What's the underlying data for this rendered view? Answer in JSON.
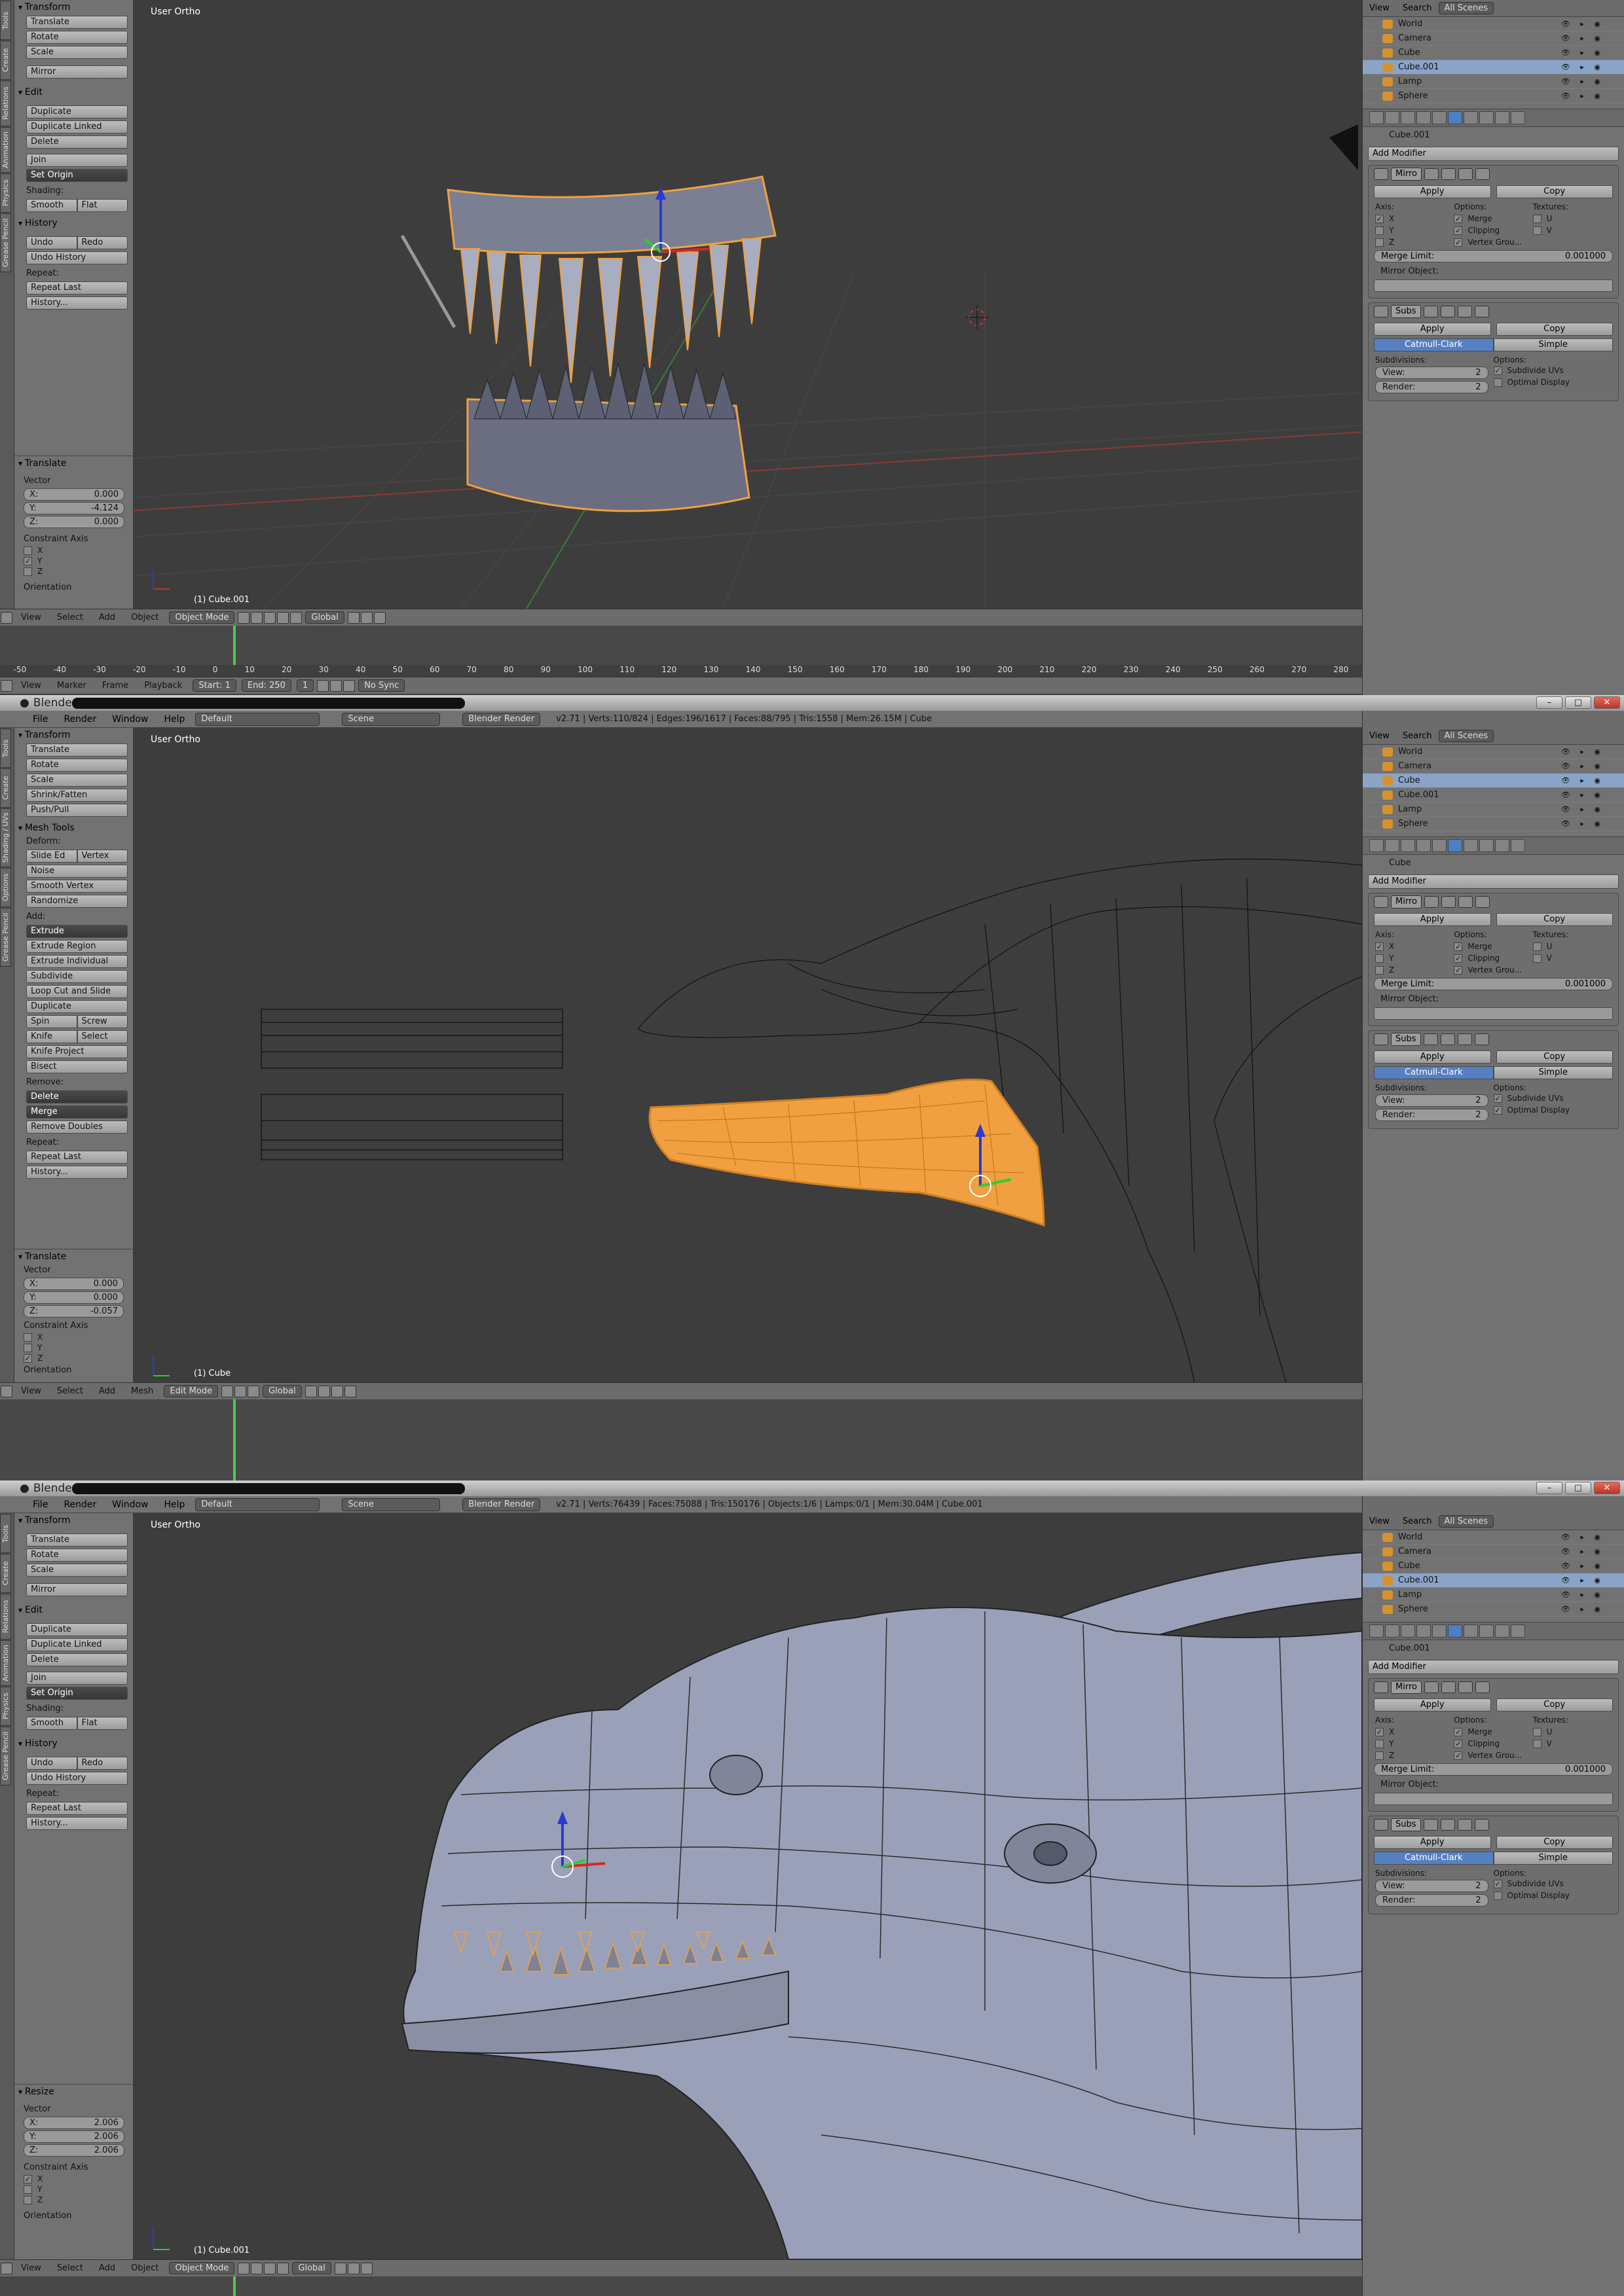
{
  "panels": [
    {
      "id": "top",
      "viewport_label": "User Ortho",
      "object_label": "(1) Cube.001",
      "mode": "Object Mode",
      "orientation": "Global",
      "tool_sections": {
        "transform_title": "Transform",
        "transform_buttons": [
          "Translate",
          "Rotate",
          "Scale"
        ],
        "mirror": "Mirror",
        "edit_title": "Edit",
        "edit_buttons": [
          "Duplicate",
          "Duplicate Linked",
          "Delete"
        ],
        "join": "Join",
        "set_origin": "Set Origin",
        "shading_label": "Shading:",
        "shading": [
          "Smooth",
          "Flat"
        ],
        "history_title": "History",
        "undo_redo": [
          "Undo",
          "Redo"
        ],
        "undo_history": "Undo History",
        "repeat_label": "Repeat:",
        "repeat_buttons": [
          "Repeat Last",
          "History..."
        ]
      },
      "operator": {
        "title": "Translate",
        "vector_label": "Vector",
        "values": [
          {
            "axis": "X:",
            "value": "0.000"
          },
          {
            "axis": "Y:",
            "value": "-4.124"
          },
          {
            "axis": "Z:",
            "value": "0.000"
          }
        ],
        "constraint_label": "Constraint Axis",
        "constraints": [
          {
            "axis": "X",
            "checked": false
          },
          {
            "axis": "Y",
            "checked": true
          },
          {
            "axis": "Z",
            "checked": false
          }
        ],
        "orientation_label": "Orientation"
      },
      "timeline": {
        "ticks": [
          "-50",
          "-40",
          "-30",
          "-20",
          "-10",
          "0",
          "10",
          "20",
          "30",
          "40",
          "50",
          "60",
          "70",
          "80",
          "90",
          "100",
          "110",
          "120",
          "130",
          "140",
          "150",
          "160",
          "170",
          "180",
          "190",
          "200",
          "210",
          "220",
          "230",
          "240",
          "250",
          "260",
          "270",
          "280"
        ],
        "menus": [
          "View",
          "Marker",
          "Frame",
          "Playback"
        ],
        "start": "Start: 1",
        "end": "End: 250",
        "current": "1",
        "sync": "No Sync"
      },
      "header_menus": [
        "View",
        "Select",
        "Add",
        "Object"
      ],
      "outliner": {
        "menus": [
          "View",
          "Search"
        ],
        "scenes": "All Scenes",
        "rows": [
          "World",
          "Camera",
          "Cube",
          "Cube.001",
          "Lamp",
          "Sphere"
        ],
        "selected": "Cube.001"
      },
      "properties": {
        "path": "Cube.001",
        "add_modifier": "Add Modifier",
        "mirror_name": "Mirro",
        "apply": "Apply",
        "copy": "Copy",
        "axis_label": "Axis:",
        "options_label": "Options:",
        "textures_label": "Textures:",
        "axes": [
          "X",
          "Y",
          "Z"
        ],
        "options": [
          "Merge",
          "Clipping",
          "Vertex Grou..."
        ],
        "textures": [
          "U",
          "V"
        ],
        "merge_limit_label": "Merge Limit:",
        "merge_limit": "0.001000",
        "mirror_object": "Mirror Object:",
        "subs_name": "Subs",
        "catmull": "Catmull-Clark",
        "simple": "Simple",
        "subdivisions_label": "Subdivisions:",
        "view": "View:",
        "view_val": "2",
        "render": "Render:",
        "render_val": "2",
        "subdivide_uvs": "Subdivide UVs",
        "optimal_display": "Optimal Display",
        "optimal_checked": false
      }
    },
    {
      "id": "middle",
      "title": "Blender*",
      "menus": [
        "File",
        "Render",
        "Window",
        "Help"
      ],
      "layout": "Default",
      "scene": "Scene",
      "engine": "Blender Render",
      "stats": "v2.71 | Verts:110/824 | Edges:196/1617 | Faces:88/795 | Tris:1558 | Mem:26.15M | Cube",
      "viewport_label": "User Ortho",
      "object_label": "(1) Cube",
      "mode": "Edit Mode",
      "orientation": "Global",
      "header_menus": [
        "View",
        "Select",
        "Add",
        "Mesh"
      ],
      "tool_sections": {
        "transform_title": "Transform",
        "transform_buttons": [
          "Translate",
          "Rotate",
          "Scale",
          "Shrink/Fatten",
          "Push/Pull"
        ],
        "mesh_tools_title": "Mesh Tools",
        "deform_label": "Deform:",
        "slide": [
          "Slide Ed",
          "Vertex"
        ],
        "deform_buttons": [
          "Noise",
          "Smooth Vertex",
          "Randomize"
        ],
        "add_label": "Add:",
        "extrude": "Extrude",
        "add_buttons": [
          "Extrude Region",
          "Extrude Individual",
          "Subdivide",
          "Loop Cut and Slide",
          "Duplicate"
        ],
        "spin_screw": [
          "Spin",
          "Screw"
        ],
        "knife_select": [
          "Knife",
          "Select"
        ],
        "add_buttons2": [
          "Knife Project",
          "Bisect"
        ],
        "remove_label": "Remove:",
        "delete": "Delete",
        "merge": "Merge",
        "remove_doubles": "Remove Doubles",
        "repeat_label": "Repeat:",
        "repeat_buttons": [
          "Repeat Last",
          "History..."
        ]
      },
      "operator": {
        "title": "Translate",
        "vector_label": "Vector",
        "values": [
          {
            "axis": "X:",
            "value": "0.000"
          },
          {
            "axis": "Y:",
            "value": "0.000"
          },
          {
            "axis": "Z:",
            "value": "-0.057"
          }
        ],
        "constraint_label": "Constraint Axis",
        "constraints": [
          {
            "axis": "X",
            "checked": false
          },
          {
            "axis": "Y",
            "checked": false
          },
          {
            "axis": "Z",
            "checked": true
          }
        ],
        "orientation_label": "Orientation"
      },
      "outliner": {
        "menus": [
          "View",
          "Search"
        ],
        "scenes": "All Scenes",
        "rows": [
          "World",
          "Camera",
          "Cube",
          "Cube.001",
          "Lamp",
          "Sphere"
        ],
        "selected": "Cube"
      },
      "properties": {
        "path": "Cube",
        "add_modifier": "Add Modifier",
        "mirror_name": "Mirro",
        "apply": "Apply",
        "copy": "Copy",
        "axis_label": "Axis:",
        "options_label": "Options:",
        "textures_label": "Textures:",
        "axes": [
          "X",
          "Y",
          "Z"
        ],
        "options": [
          "Merge",
          "Clipping",
          "Vertex Grou..."
        ],
        "textures": [
          "U",
          "V"
        ],
        "merge_limit_label": "Merge Limit:",
        "merge_limit": "0.001000",
        "mirror_object": "Mirror Object:",
        "subs_name": "Subs",
        "catmull": "Catmull-Clark",
        "simple": "Simple",
        "subdivisions_label": "Subdivisions:",
        "view": "View:",
        "view_val": "2",
        "render": "Render:",
        "render_val": "2",
        "subdivide_uvs": "Subdivide UVs",
        "optimal_display": "Optimal Display",
        "optimal_checked": true
      }
    },
    {
      "id": "bottom",
      "title": "Blender*",
      "menus": [
        "File",
        "Render",
        "Window",
        "Help"
      ],
      "layout": "Default",
      "scene": "Scene",
      "engine": "Blender Render",
      "stats": "v2.71 | Verts:76439 | Faces:75088 | Tris:150176 | Objects:1/6 | Lamps:0/1 | Mem:30.04M | Cube.001",
      "viewport_label": "User Ortho",
      "object_label": "(1) Cube.001",
      "mode": "Object Mode",
      "orientation": "Global",
      "header_menus": [
        "View",
        "Select",
        "Add",
        "Object"
      ],
      "tool_sections": {
        "transform_title": "Transform",
        "transform_buttons": [
          "Translate",
          "Rotate",
          "Scale"
        ],
        "mirror": "Mirror",
        "edit_title": "Edit",
        "edit_buttons": [
          "Duplicate",
          "Duplicate Linked",
          "Delete"
        ],
        "join": "Join",
        "set_origin": "Set Origin",
        "shading_label": "Shading:",
        "shading": [
          "Smooth",
          "Flat"
        ],
        "history_title": "History",
        "undo_redo": [
          "Undo",
          "Redo"
        ],
        "undo_history": "Undo History",
        "repeat_label": "Repeat:",
        "repeat_buttons": [
          "Repeat Last",
          "History..."
        ]
      },
      "operator": {
        "title": "Resize",
        "vector_label": "Vector",
        "values": [
          {
            "axis": "X:",
            "value": "2.006"
          },
          {
            "axis": "Y:",
            "value": "2.006"
          },
          {
            "axis": "Z:",
            "value": "2.006"
          }
        ],
        "constraint_label": "Constraint Axis",
        "constraints": [
          {
            "axis": "X",
            "checked": true
          },
          {
            "axis": "Y",
            "checked": false
          },
          {
            "axis": "Z",
            "checked": false
          }
        ],
        "orientation_label": "Orientation"
      },
      "outliner": {
        "menus": [
          "View",
          "Search"
        ],
        "scenes": "All Scenes",
        "rows": [
          "World",
          "Camera",
          "Cube",
          "Cube.001",
          "Lamp",
          "Sphere"
        ],
        "selected": "Cube.001"
      },
      "properties": {
        "path": "Cube.001",
        "add_modifier": "Add Modifier",
        "mirror_name": "Mirro",
        "apply": "Apply",
        "copy": "Copy",
        "axis_label": "Axis:",
        "options_label": "Options:",
        "textures_label": "Textures:",
        "axes": [
          "X",
          "Y",
          "Z"
        ],
        "options": [
          "Merge",
          "Clipping",
          "Vertex Grou..."
        ],
        "textures": [
          "U",
          "V"
        ],
        "merge_limit_label": "Merge Limit:",
        "merge_limit": "0.001000",
        "mirror_object": "Mirror Object:",
        "subs_name": "Subs",
        "catmull": "Catmull-Clark",
        "simple": "Simple",
        "subdivisions_label": "Subdivisions:",
        "view": "View:",
        "view_val": "2",
        "render": "Render:",
        "render_val": "2",
        "subdivide_uvs": "Subdivide UVs",
        "optimal_display": "Optimal Display",
        "optimal_checked": false
      }
    }
  ],
  "side_tabs_object": [
    "Tools",
    "Create",
    "Relations",
    "Animation",
    "Physics",
    "Grease Pencil"
  ],
  "side_tabs_edit": [
    "Tools",
    "Create",
    "Shading / UVs",
    "Options",
    "Grease Pencil"
  ],
  "colors": {
    "selection_orange": "#f0a040",
    "active_blue": "#5680c2",
    "timeline_cursor": "#4fcc4f",
    "mesh_gray": "#9aa0b8"
  }
}
